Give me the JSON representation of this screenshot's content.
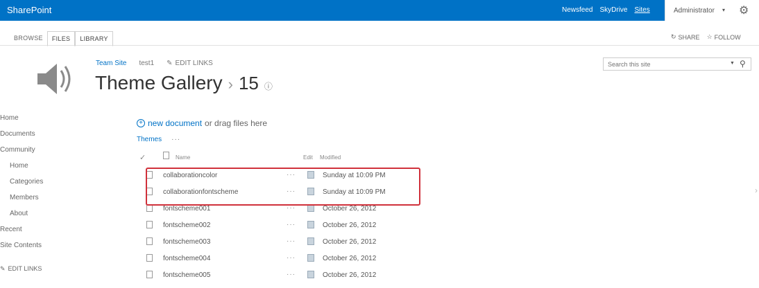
{
  "suite": {
    "brand": "SharePoint",
    "links": [
      "Newsfeed",
      "SkyDrive",
      "Sites"
    ],
    "user": "Administrator",
    "colors": {
      "bar": "#0072c6"
    }
  },
  "ribbon": {
    "tabs": [
      "BROWSE",
      "FILES",
      "LIBRARY"
    ],
    "share": "SHARE",
    "follow": "FOLLOW"
  },
  "header": {
    "breadcrumbs": {
      "site": "Team Site",
      "sub": "test1",
      "edit_links": "EDIT LINKS"
    },
    "title": "Theme Gallery",
    "separator": "›",
    "count": "15",
    "search_placeholder": "Search this site"
  },
  "leftnav": {
    "items": [
      "Home",
      "Documents",
      "Community",
      "Home",
      "Categories",
      "Members",
      "About",
      "Recent",
      "Site Contents"
    ],
    "edit_links": "EDIT LINKS"
  },
  "content": {
    "new_doc_link": "new document",
    "new_doc_rest": "or drag files here",
    "view": "Themes",
    "view_more": "···",
    "columns": {
      "name": "Name",
      "edit": "Edit",
      "modified": "Modified"
    },
    "rows": [
      {
        "name": "collaborationcolor",
        "modified": "Sunday at 10:09 PM"
      },
      {
        "name": "collaborationfontscheme",
        "modified": "Sunday at 10:09 PM"
      },
      {
        "name": "fontscheme001",
        "modified": "October 26, 2012"
      },
      {
        "name": "fontscheme002",
        "modified": "October 26, 2012"
      },
      {
        "name": "fontscheme003",
        "modified": "October 26, 2012"
      },
      {
        "name": "fontscheme004",
        "modified": "October 26, 2012"
      },
      {
        "name": "fontscheme005",
        "modified": "October 26, 2012"
      }
    ],
    "ellipsis": "···"
  }
}
